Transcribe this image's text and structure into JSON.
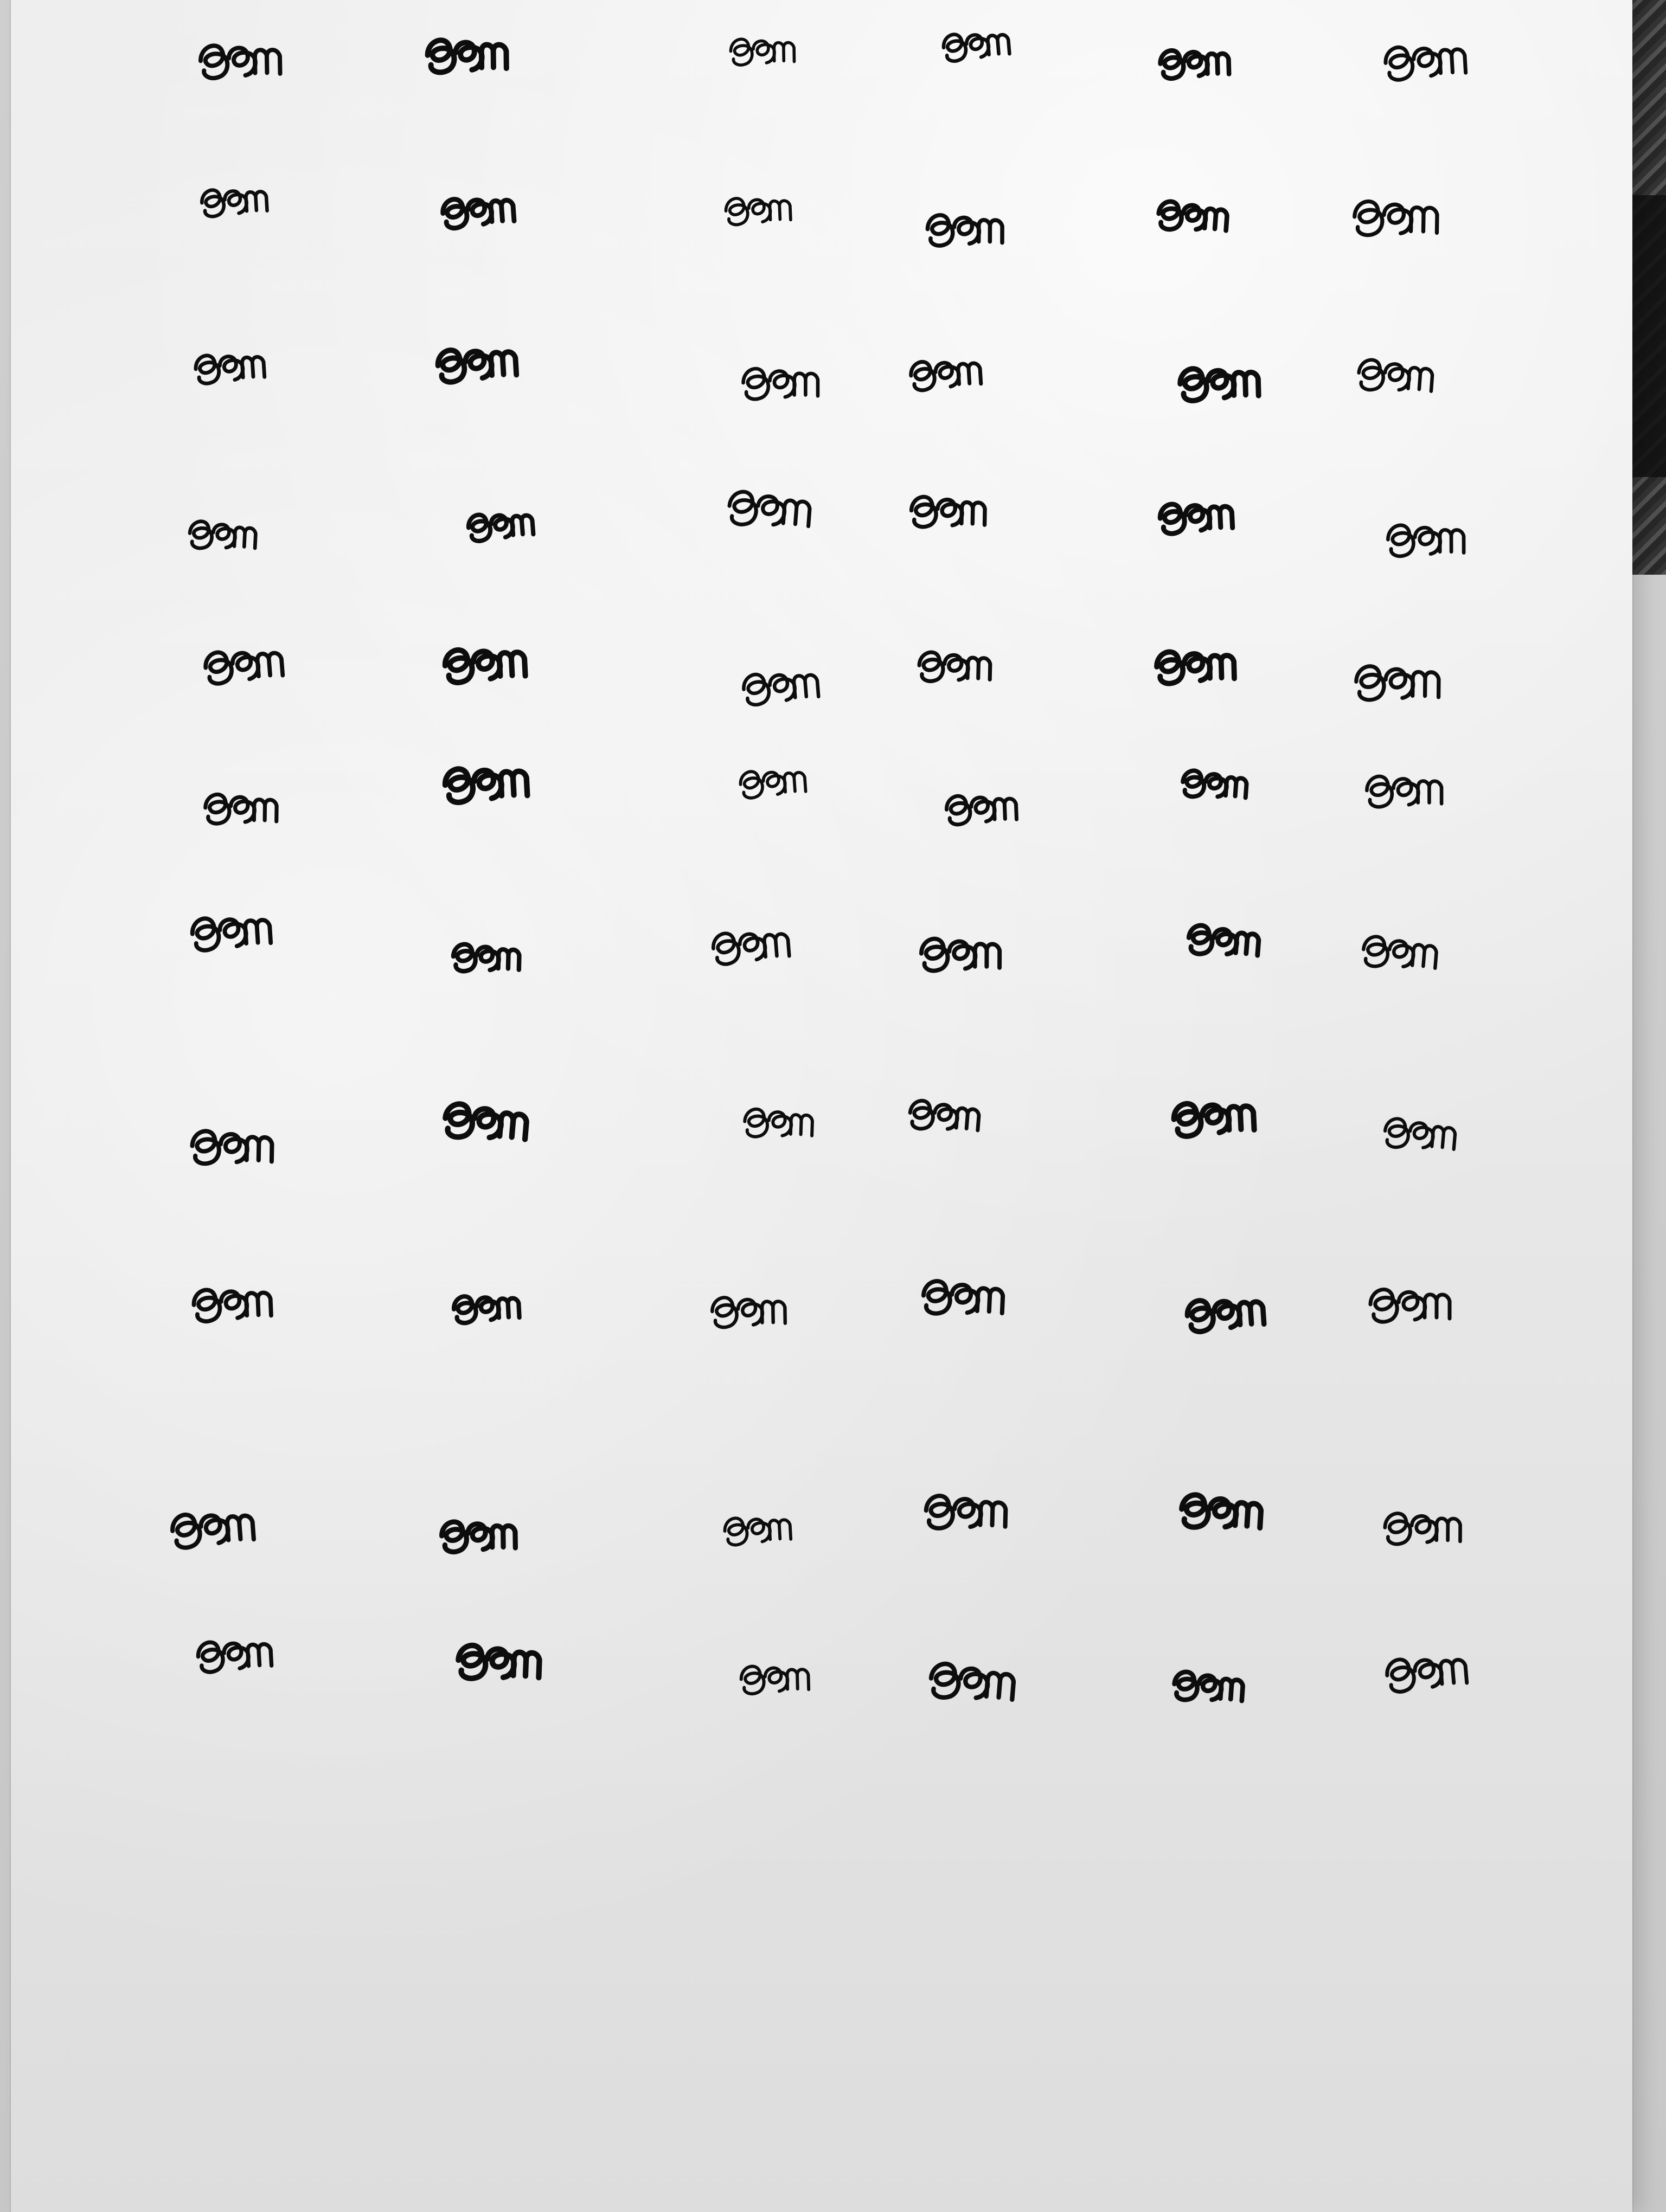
{
  "scene": {
    "content": "handwritten-practice-sheet",
    "glyph_rows": 11,
    "glyph_cols": 6,
    "glyph_count": 66
  },
  "colors": {
    "ink": "#0d0d0d",
    "paper": "#eeeeee",
    "background": "#c9c9c9"
  }
}
